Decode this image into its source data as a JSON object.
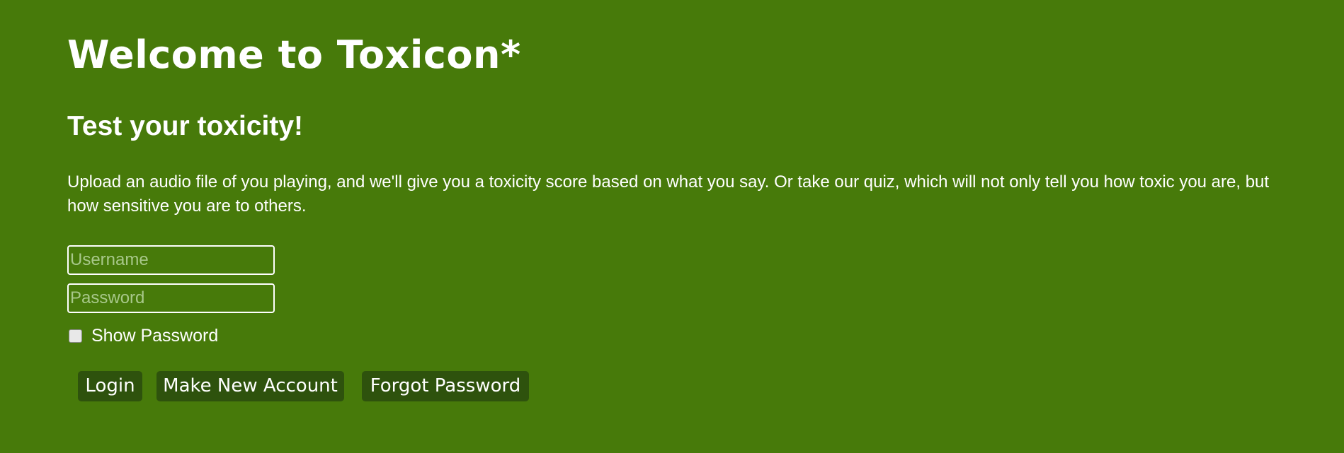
{
  "header": {
    "title": "Welcome to Toxicon*",
    "subtitle": "Test your toxicity!"
  },
  "intro": {
    "description": "Upload an audio file of you playing, and we'll give you a toxicity score based on what you say. Or take our quiz, which will not only tell you how toxic you are, but how sensitive you are to others."
  },
  "login_form": {
    "username": {
      "value": "",
      "placeholder": "Username"
    },
    "password": {
      "value": "",
      "placeholder": "Password"
    },
    "show_password": {
      "label": "Show Password",
      "checked": false
    },
    "buttons": {
      "login": "Login",
      "new_account": "Make New Account",
      "forgot_password": "Forgot Password"
    }
  }
}
